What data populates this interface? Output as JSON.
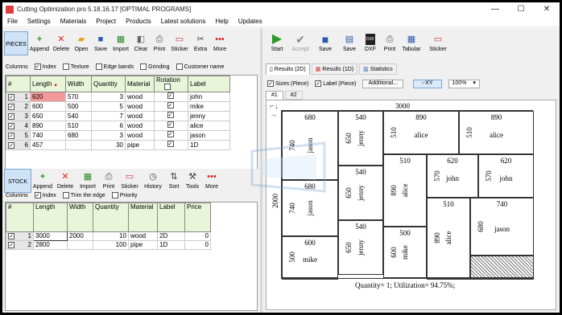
{
  "window": {
    "title": "Cutting Optimization pro 5.18.16.17 [OPTIMAL PROGRAMS]"
  },
  "menu": [
    "File",
    "Settings",
    "Materials",
    "Project",
    "Products",
    "Latest solutions",
    "Help",
    "Updates"
  ],
  "pieces_toolbar": {
    "tab": "PIECES",
    "buttons": [
      "Append",
      "Delete",
      "Open",
      "Save",
      "Import",
      "Clear",
      "Print",
      "Sticker",
      "Extra",
      "More"
    ]
  },
  "pieces_options": {
    "columns_label": "Columns",
    "options": [
      {
        "label": "Index",
        "checked": true
      },
      {
        "label": "Texture",
        "checked": false
      },
      {
        "label": "Edge bands",
        "checked": false
      },
      {
        "label": "Grinding",
        "checked": false
      },
      {
        "label": "Customer name",
        "checked": false
      }
    ]
  },
  "pieces_table": {
    "headers": [
      "#",
      "Length",
      "Width",
      "Quantity",
      "Material",
      "Rotation",
      "Label"
    ],
    "rows": [
      {
        "idx": "1",
        "length": "620",
        "width": "570",
        "qty": "3",
        "mat": "wood",
        "rot": true,
        "label": "john"
      },
      {
        "idx": "2",
        "length": "600",
        "width": "500",
        "qty": "5",
        "mat": "wood",
        "rot": true,
        "label": "mike"
      },
      {
        "idx": "3",
        "length": "650",
        "width": "540",
        "qty": "7",
        "mat": "wood",
        "rot": true,
        "label": "jenny"
      },
      {
        "idx": "4",
        "length": "890",
        "width": "510",
        "qty": "6",
        "mat": "wood",
        "rot": true,
        "label": "alice"
      },
      {
        "idx": "5",
        "length": "740",
        "width": "680",
        "qty": "3",
        "mat": "wood",
        "rot": true,
        "label": "jason"
      },
      {
        "idx": "6",
        "length": "457",
        "width": "",
        "qty": "30",
        "mat": "pipe",
        "rot": true,
        "label": "1D"
      }
    ]
  },
  "stock_toolbar": {
    "tab": "STOCK",
    "buttons": [
      "Append",
      "Delete",
      "Import",
      "Print",
      "Sticker",
      "History",
      "Sort",
      "Tools",
      "More"
    ]
  },
  "stock_options": {
    "columns_label": "Columns",
    "options": [
      {
        "label": "Index",
        "checked": true
      },
      {
        "label": "Trim the edge",
        "checked": false
      },
      {
        "label": "Priority",
        "checked": false
      }
    ]
  },
  "stock_table": {
    "headers": [
      "#",
      "Length",
      "Width",
      "Quantity",
      "Material",
      "Label",
      "Price"
    ],
    "rows": [
      {
        "idx": "1",
        "length": "3000",
        "width": "2000",
        "qty": "10",
        "mat": "wood",
        "label": "2D",
        "price": "0"
      },
      {
        "idx": "2",
        "length": "2800",
        "width": "",
        "qty": "100",
        "mat": "pipe",
        "label": "1D",
        "price": "0"
      }
    ]
  },
  "right_toolbar": {
    "buttons": [
      "Start",
      "Accept",
      "Save",
      "Save",
      "DXF",
      "Print",
      "Tabular",
      "Sticker"
    ]
  },
  "result_tabs": [
    "Results (2D)",
    "Results (1D)",
    "Statistics"
  ],
  "view_options": {
    "sizes": "Sizes (Piece)",
    "label": "Label (Piece)",
    "additional": "Additional...",
    "xy": "XY",
    "zoom": "100%"
  },
  "sheet_tabs": [
    "#1",
    "#2"
  ],
  "sheet": {
    "width_label": "3000",
    "height_label": "2000",
    "footer": "Quantity= 1; Utilization= 94.75%;"
  },
  "pieces_drawn": [
    {
      "w": "680",
      "h": "740",
      "name": "jason",
      "vert": true
    },
    {
      "w": "540",
      "h": "650",
      "name": "jenny",
      "vert": true
    },
    {
      "w": "890",
      "h": "510",
      "name": "alice",
      "vert": false
    },
    {
      "w": "890",
      "h": "510",
      "name": "alice",
      "vert": false
    },
    {
      "w": "680",
      "h": "740",
      "name": "jason",
      "vert": true
    },
    {
      "w": "540",
      "h": "650",
      "name": "jenny",
      "vert": true
    },
    {
      "w": "510",
      "h": "890",
      "name": "alice",
      "vert": true
    },
    {
      "w": "620",
      "h": "570",
      "name": "john",
      "vert": false
    },
    {
      "w": "620",
      "h": "570",
      "name": "john",
      "vert": false
    },
    {
      "w": "540",
      "h": "650",
      "name": "jenny",
      "vert": true
    },
    {
      "w": "500",
      "h": "600",
      "name": "mike",
      "vert": true
    },
    {
      "w": "510",
      "h": "890",
      "name": "alice",
      "vert": true
    },
    {
      "w": "740",
      "h": "680",
      "name": "jason",
      "vert": false
    },
    {
      "w": "600",
      "h": "500",
      "name": "mike",
      "vert": false
    }
  ]
}
